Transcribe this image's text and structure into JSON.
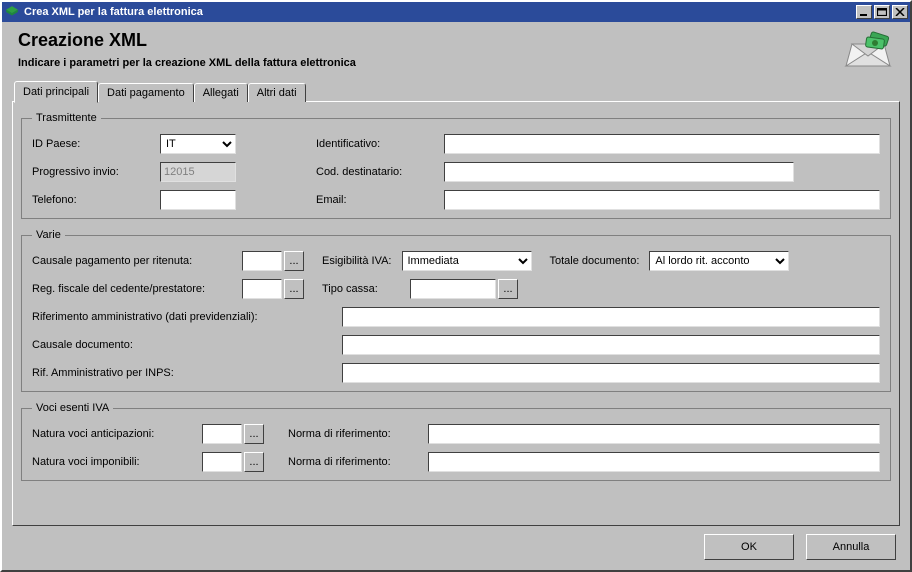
{
  "window": {
    "title": "Crea XML per la fattura elettronica"
  },
  "header": {
    "title": "Creazione XML",
    "subtitle": "Indicare i parametri per la creazione XML della fattura elettronica"
  },
  "tabs": {
    "t0": "Dati principali",
    "t1": "Dati pagamento",
    "t2": "Allegati",
    "t3": "Altri dati"
  },
  "trasmittente": {
    "legend": "Trasmittente",
    "id_paese_label": "ID Paese:",
    "id_paese_value": "IT",
    "identificativo_label": "Identificativo:",
    "identificativo_value": "",
    "progressivo_label": "Progressivo invio:",
    "progressivo_value": "12015",
    "cod_dest_label": "Cod. destinatario:",
    "cod_dest_value": "",
    "telefono_label": "Telefono:",
    "telefono_value": "",
    "email_label": "Email:",
    "email_value": ""
  },
  "varie": {
    "legend": "Varie",
    "causale_rit_label": "Causale pagamento per ritenuta:",
    "causale_rit_value": "",
    "esig_iva_label": "Esigibilità IVA:",
    "esig_iva_value": "Immediata",
    "totale_doc_label": "Totale documento:",
    "totale_doc_value": "Al lordo rit. acconto",
    "reg_fisc_label": "Reg. fiscale del cedente/prestatore:",
    "reg_fisc_value": "",
    "tipo_cassa_label": "Tipo cassa:",
    "tipo_cassa_value": "",
    "rif_amm_prev_label": "Riferimento amministrativo (dati previdenziali):",
    "rif_amm_prev_value": "",
    "causale_doc_label": "Causale documento:",
    "causale_doc_value": "",
    "rif_amm_inps_label": "Rif. Amministrativo per INPS:",
    "rif_amm_inps_value": ""
  },
  "voci": {
    "legend": "Voci esenti IVA",
    "nat_ant_label": "Natura voci anticipazioni:",
    "nat_ant_value": "",
    "norma_rif1_label": "Norma di riferimento:",
    "norma_rif1_value": "",
    "nat_imp_label": "Natura voci imponibili:",
    "nat_imp_value": "",
    "norma_rif2_label": "Norma di riferimento:",
    "norma_rif2_value": ""
  },
  "buttons": {
    "ok": "OK",
    "annulla": "Annulla",
    "dots": "..."
  }
}
